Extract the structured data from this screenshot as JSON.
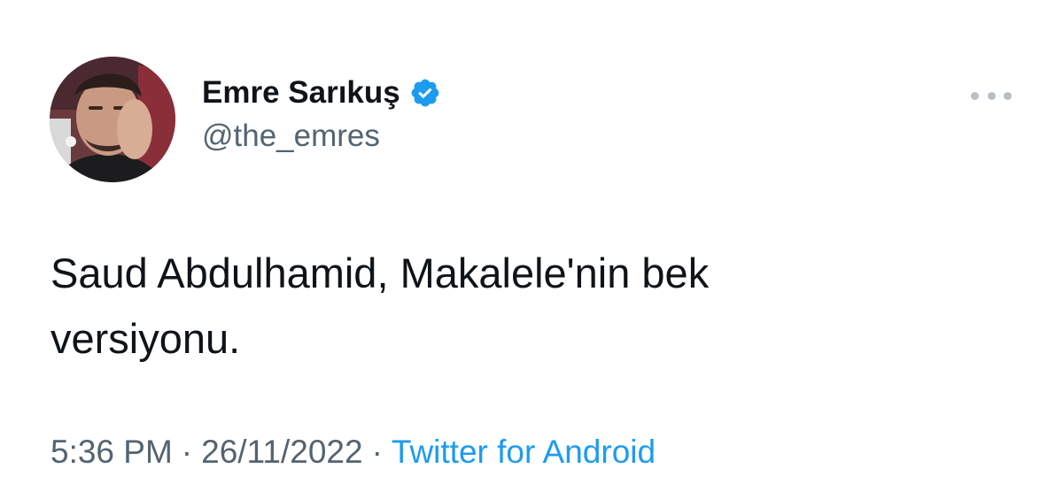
{
  "tweet": {
    "author": {
      "display_name": "Emre Sarıkuş",
      "handle": "@the_emres",
      "verified": true
    },
    "icons": {
      "avatar": "profile-photo",
      "verified": "verified-badge-icon",
      "more": "more-options-icon"
    },
    "text_lines": [
      "Saud Abdulhamid, Makalele'nin bek",
      "versiyonu."
    ],
    "meta": {
      "time": "5:36 PM",
      "separator": "·",
      "date": "26/11/2022",
      "source": "Twitter for Android"
    }
  },
  "colors": {
    "text_primary": "#0f1419",
    "text_secondary": "#536471",
    "accent": "#1d9bf0",
    "background": "#ffffff"
  }
}
